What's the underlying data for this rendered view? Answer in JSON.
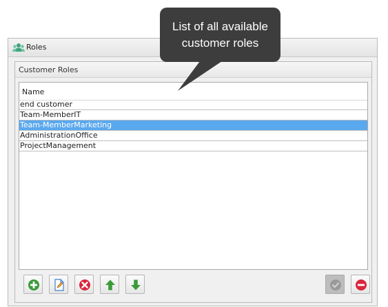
{
  "window": {
    "title": "Roles",
    "title_icon": "users-icon"
  },
  "group": {
    "title": "Customer Roles"
  },
  "grid": {
    "columns": [
      "Name"
    ],
    "rows": [
      "end customer",
      "Team-MemberIT",
      "Team-MemberMarketing",
      "AdministrationOffice",
      "ProjectManagement"
    ],
    "selected_index": 2
  },
  "toolbar": {
    "buttons": [
      {
        "name": "add-button",
        "icon": "plus-circle-icon",
        "color": "#3a9b3a",
        "enabled": true
      },
      {
        "name": "edit-button",
        "icon": "edit-document-icon",
        "color": "#3c7fd0",
        "enabled": true
      },
      {
        "name": "delete-button",
        "icon": "x-circle-icon",
        "color": "#d9263b",
        "enabled": true
      },
      {
        "name": "move-up-button",
        "icon": "arrow-up-icon",
        "color": "#3a9b3a",
        "enabled": true
      },
      {
        "name": "move-down-button",
        "icon": "arrow-down-icon",
        "color": "#3a9b3a",
        "enabled": true
      },
      {
        "name": "confirm-button",
        "icon": "check-circle-icon",
        "color": "#9a9a9a",
        "enabled": false
      },
      {
        "name": "cancel-button",
        "icon": "minus-circle-icon",
        "color": "#d9263b",
        "enabled": true
      }
    ]
  },
  "callout": {
    "line1": "List of all available",
    "line2": "customer roles"
  },
  "colors": {
    "selection": "#5aa8ee",
    "callout_bg": "#3d3d3d"
  }
}
